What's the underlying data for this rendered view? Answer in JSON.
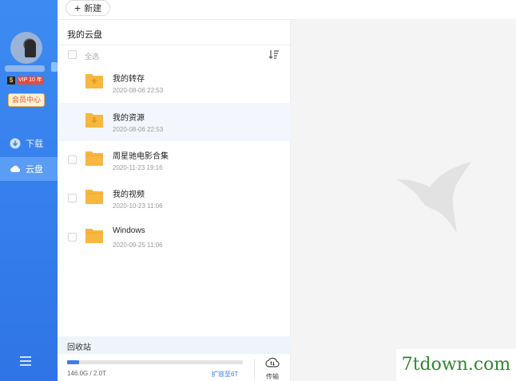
{
  "topbar": {
    "new_label": "新建"
  },
  "sidebar": {
    "vip_label": "VIP 10 年",
    "member_center": "会员中心",
    "nav": [
      {
        "label": "下载",
        "icon": "download-icon",
        "active": false
      },
      {
        "label": "云盘",
        "icon": "cloud-icon",
        "active": true
      }
    ]
  },
  "panel": {
    "title": "我的云盘",
    "select_all": "全选",
    "files": [
      {
        "name": "我的转存",
        "date": "2020-08-06 22:53",
        "icon": "folder-transfer-icon"
      },
      {
        "name": "我的资源",
        "date": "2020-08-06 22:53",
        "icon": "folder-resource-icon"
      },
      {
        "name": "周星驰电影合集",
        "date": "2020-11-23 19:16",
        "icon": "folder-icon"
      },
      {
        "name": "我的视频",
        "date": "2020-10-23 11:06",
        "icon": "folder-icon"
      },
      {
        "name": "Windows",
        "date": "2020-09-25 11:06",
        "icon": "folder-icon"
      }
    ],
    "recycle": "回收站",
    "storage": {
      "used_text": "146.0G / 2.0T",
      "used_fraction": 0.07,
      "expand_label": "扩容至6T",
      "transfer_label": "传输"
    }
  },
  "watermark": "7tdown.com",
  "colors": {
    "accent": "#3d7fe6",
    "sidebar": "#2f74e6",
    "folder": "#f8b73f"
  }
}
